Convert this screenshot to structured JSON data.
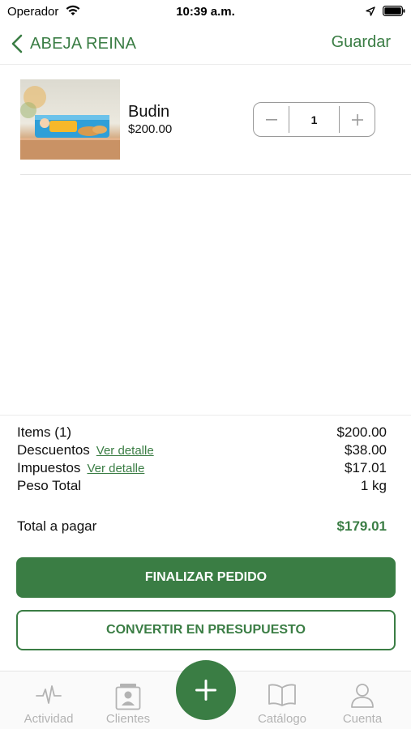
{
  "status_bar": {
    "carrier": "Operador",
    "time": "10:39 a.m."
  },
  "nav": {
    "title": "ABEJA REINA",
    "save_label": "Guardar"
  },
  "cart": {
    "items": [
      {
        "name": "Budin",
        "price": "$200.00",
        "quantity": "1",
        "image_label": "Budin"
      }
    ]
  },
  "summary": {
    "items_label": "Items (1)",
    "items_value": "$200.00",
    "discounts_label": "Descuentos",
    "discounts_link": "Ver detalle",
    "discounts_value": "$38.00",
    "taxes_label": "Impuestos",
    "taxes_link": "Ver detalle",
    "taxes_value": "$17.01",
    "weight_label": "Peso Total",
    "weight_value": "1 kg",
    "total_label": "Total a pagar",
    "total_value": "$179.01"
  },
  "actions": {
    "finalize_label": "FINALIZAR PEDIDO",
    "convert_label": "CONVERTIR EN PRESUPUESTO"
  },
  "tabs": [
    {
      "label": "Actividad",
      "icon": "activity-icon"
    },
    {
      "label": "Clientes",
      "icon": "clients-icon"
    },
    {
      "label": "Catálogo",
      "icon": "catalog-icon"
    },
    {
      "label": "Cuenta",
      "icon": "account-icon"
    }
  ],
  "colors": {
    "accent": "#3a7d44",
    "tab_inactive": "#b3b3b3"
  }
}
